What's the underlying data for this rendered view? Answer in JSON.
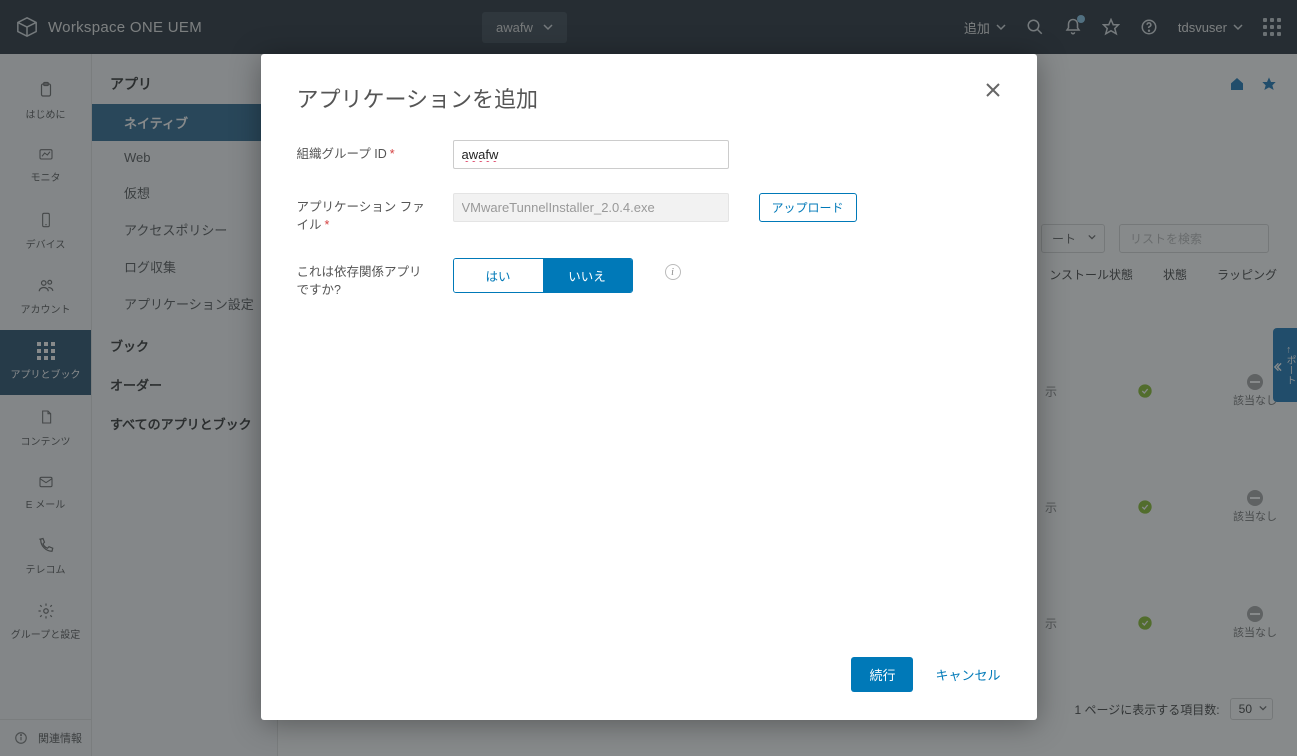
{
  "header": {
    "brand": "Workspace ONE UEM",
    "org_selected": "awafw",
    "add_label": "追加",
    "user": "tdsvuser"
  },
  "rail": {
    "items": [
      {
        "label": "はじめに"
      },
      {
        "label": "モニタ"
      },
      {
        "label": "デバイス"
      },
      {
        "label": "アカウント"
      },
      {
        "label": "アプリとブック"
      },
      {
        "label": "コンテンツ"
      },
      {
        "label": "E メール"
      },
      {
        "label": "テレコム"
      },
      {
        "label": "グループと設定"
      }
    ],
    "footer": "関連情報"
  },
  "sidebar": {
    "title": "アプリ",
    "items": [
      "ネイティブ",
      "Web",
      "仮想",
      "アクセスポリシー",
      "ログ収集",
      "アプリケーション設定"
    ],
    "groups": [
      "ブック",
      "オーダー",
      "すべてのアプリとブック"
    ]
  },
  "content": {
    "export_label": "ート",
    "search_placeholder": "リストを検索",
    "columns": [
      "ンストール状態",
      "状態",
      "ラッピング"
    ],
    "row_value1": "示",
    "row_na": "該当なし",
    "pager_prefix": "1 ページに表示する項目数:",
    "pager_value": "50",
    "side_tab": "←ポート"
  },
  "modal": {
    "title": "アプリケーションを追加",
    "fields": {
      "org_label": "組織グループ ID",
      "org_value": "awafw",
      "file_label": "アプリケーション ファイル",
      "file_value": "VMwareTunnelInstaller_2.0.4.exe",
      "upload_btn": "アップロード",
      "dep_label": "これは依存関係アプリですか?",
      "yes": "はい",
      "no": "いいえ"
    },
    "footer": {
      "continue": "続行",
      "cancel": "キャンセル"
    }
  }
}
